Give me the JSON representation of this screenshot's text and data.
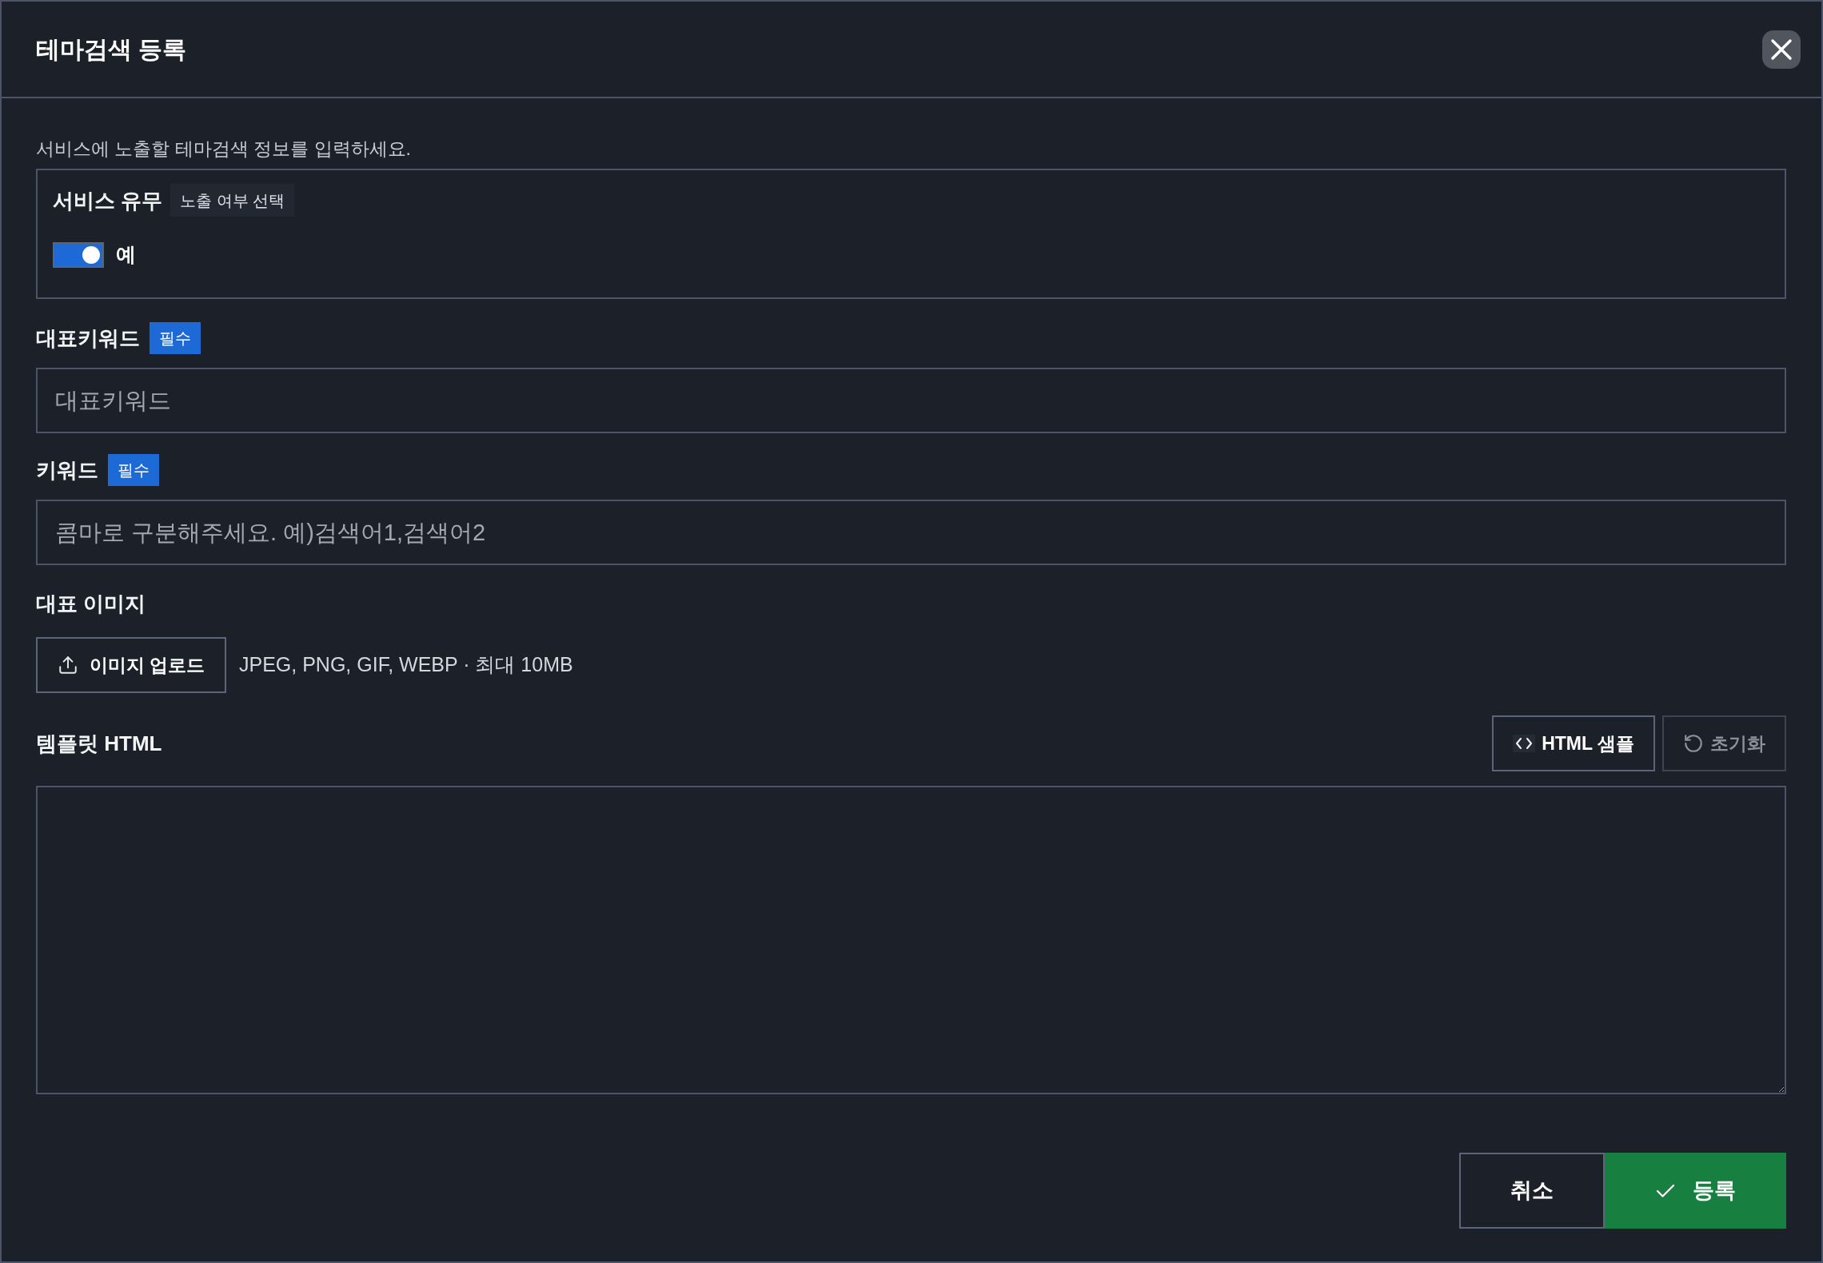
{
  "dialog": {
    "title": "테마검색 등록"
  },
  "description": "서비스에 노출할 테마검색 정보를 입력하세요.",
  "service": {
    "label": "서비스 유무",
    "tag": "노출 여부 선택",
    "toggle": {
      "on": true,
      "label": "예"
    }
  },
  "fields": [
    {
      "kind": "input",
      "label": "대표키워드",
      "badge": "필수",
      "placeholder": "대표키워드"
    },
    {
      "kind": "input",
      "label": "키워드",
      "badge": "필수",
      "placeholder": "콤마로 구분해주세요. 예)검색어1,검색어2"
    },
    {
      "kind": "upload",
      "label": "대표 이미지",
      "button": "이미지 업로드",
      "hint": "JPEG, PNG, GIF, WEBP · 최대 10MB"
    },
    {
      "kind": "textarea",
      "label": "템플릿 HTML",
      "actions": [
        {
          "kind": "code",
          "label": "HTML 샘플",
          "disabled": false
        },
        {
          "kind": "reset",
          "label": "초기화",
          "disabled": true
        }
      ]
    }
  ],
  "footer": {
    "buttons": [
      {
        "kind": "secondary",
        "label": "취소"
      },
      {
        "kind": "primary",
        "label": "등록"
      }
    ]
  }
}
